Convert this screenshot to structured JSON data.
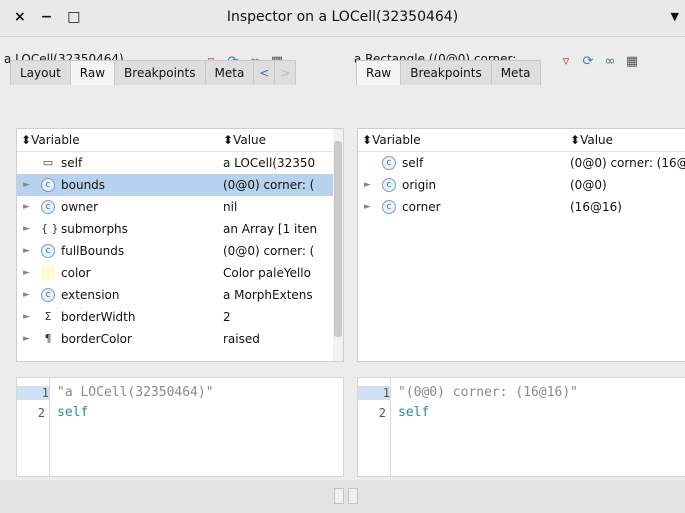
{
  "window": {
    "controls": [
      "×",
      "−",
      "□"
    ],
    "title": "Inspector on a LOCell(32350464)",
    "menu_icon": "triangle-down-icon"
  },
  "left": {
    "title": "a LOCell(32350464)",
    "tools": [
      "filter-icon",
      "refresh-icon",
      "glasses-icon",
      "pin-icon"
    ],
    "tabs": [
      "Layout",
      "Raw",
      "Breakpoints",
      "Meta"
    ],
    "active_tab": "Raw",
    "columns": [
      "Variable",
      "Value"
    ],
    "rows": [
      {
        "name": "self",
        "value": "a LOCell(32350",
        "icon": "window-icon",
        "expand": "",
        "selected": false
      },
      {
        "name": "bounds",
        "value": "(0@0) corner: (",
        "icon": "c",
        "expand": "►",
        "selected": true
      },
      {
        "name": "owner",
        "value": "nil",
        "icon": "c",
        "expand": "►",
        "selected": false
      },
      {
        "name": "submorphs",
        "value": "an Array [1 iten",
        "icon": "{ }",
        "expand": "►",
        "selected": false
      },
      {
        "name": "fullBounds",
        "value": "(0@0) corner: (",
        "icon": "c",
        "expand": "►",
        "selected": false
      },
      {
        "name": "color",
        "value": "Color paleYello",
        "icon": "swatch",
        "expand": "►",
        "selected": false
      },
      {
        "name": "extension",
        "value": "a MorphExtens",
        "icon": "c",
        "expand": "►",
        "selected": false
      },
      {
        "name": "borderWidth",
        "value": "2",
        "icon": "Σ",
        "expand": "►",
        "selected": false
      },
      {
        "name": "borderColor",
        "value": "raised",
        "icon": "¶",
        "expand": "►",
        "selected": false
      }
    ],
    "code": [
      {
        "num": "1",
        "text": "\"a LOCell(32350464)\""
      },
      {
        "num": "2",
        "text": "self"
      }
    ]
  },
  "right": {
    "title": "a Rectangle ((0@0) corner: ...",
    "tools": [
      "filter-icon",
      "refresh-icon",
      "glasses-icon",
      "pin-icon"
    ],
    "tabs": [
      "Raw",
      "Breakpoints",
      "Meta"
    ],
    "active_tab": "Raw",
    "columns": [
      "Variable",
      "Value"
    ],
    "rows": [
      {
        "name": "self",
        "value": "(0@0) corner: (16@",
        "icon": "c",
        "expand": "",
        "selected": false
      },
      {
        "name": "origin",
        "value": "(0@0)",
        "icon": "c",
        "expand": "►",
        "selected": false
      },
      {
        "name": "corner",
        "value": "(16@16)",
        "icon": "c",
        "expand": "►",
        "selected": false
      }
    ],
    "code": [
      {
        "num": "1",
        "text": "\"(0@0) corner: (16@16)\""
      },
      {
        "num": "2",
        "text": "self"
      }
    ]
  }
}
